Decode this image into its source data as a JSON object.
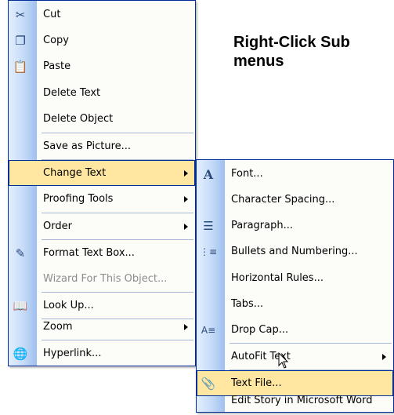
{
  "heading": {
    "line1": "Right-Click Sub",
    "line2": "menus"
  },
  "main_menu": {
    "items": [
      {
        "label": "Cut",
        "icon": "scissors-icon",
        "glyph": "✂"
      },
      {
        "label": "Copy",
        "icon": "copy-icon",
        "glyph": "❐"
      },
      {
        "label": "Paste",
        "icon": "paste-icon",
        "glyph": "📋"
      },
      {
        "label": "Delete Text"
      },
      {
        "label": "Delete Object"
      },
      {
        "label": "Save as Picture..."
      },
      {
        "label": "Change Text",
        "submenu": true,
        "highlighted": true
      },
      {
        "label": "Proofing Tools",
        "submenu": true
      },
      {
        "label": "Order",
        "submenu": true
      },
      {
        "label": "Format Text Box...",
        "icon": "format-text-box-icon",
        "glyph": "✎"
      },
      {
        "label": "Wizard For This Object...",
        "disabled": true
      },
      {
        "label": "Look Up...",
        "icon": "look-up-icon",
        "glyph": "📖"
      },
      {
        "label": "Zoom",
        "submenu": true
      },
      {
        "label": "Hyperlink...",
        "icon": "hyperlink-icon",
        "glyph": "🌐"
      }
    ]
  },
  "sub_menu": {
    "items": [
      {
        "label": "Font...",
        "icon": "font-icon",
        "glyph": "A"
      },
      {
        "label": "Character Spacing..."
      },
      {
        "label": "Paragraph...",
        "icon": "paragraph-icon",
        "glyph": "☰"
      },
      {
        "label": "Bullets and Numbering...",
        "icon": "bullets-icon",
        "glyph": "⋮≡"
      },
      {
        "label": "Horizontal Rules..."
      },
      {
        "label": "Tabs..."
      },
      {
        "label": "Drop Cap...",
        "icon": "drop-cap-icon",
        "glyph": "A≡"
      },
      {
        "label": "AutoFit Text",
        "submenu": true
      },
      {
        "label": "Text File...",
        "icon": "paperclip-icon",
        "glyph": "📎",
        "highlighted": true
      },
      {
        "label": "Edit Story in Microsoft Word"
      }
    ]
  },
  "colors": {
    "menu_border": "#002d96",
    "highlight": "#ffe7a2",
    "gutter": "#9ebfef"
  }
}
